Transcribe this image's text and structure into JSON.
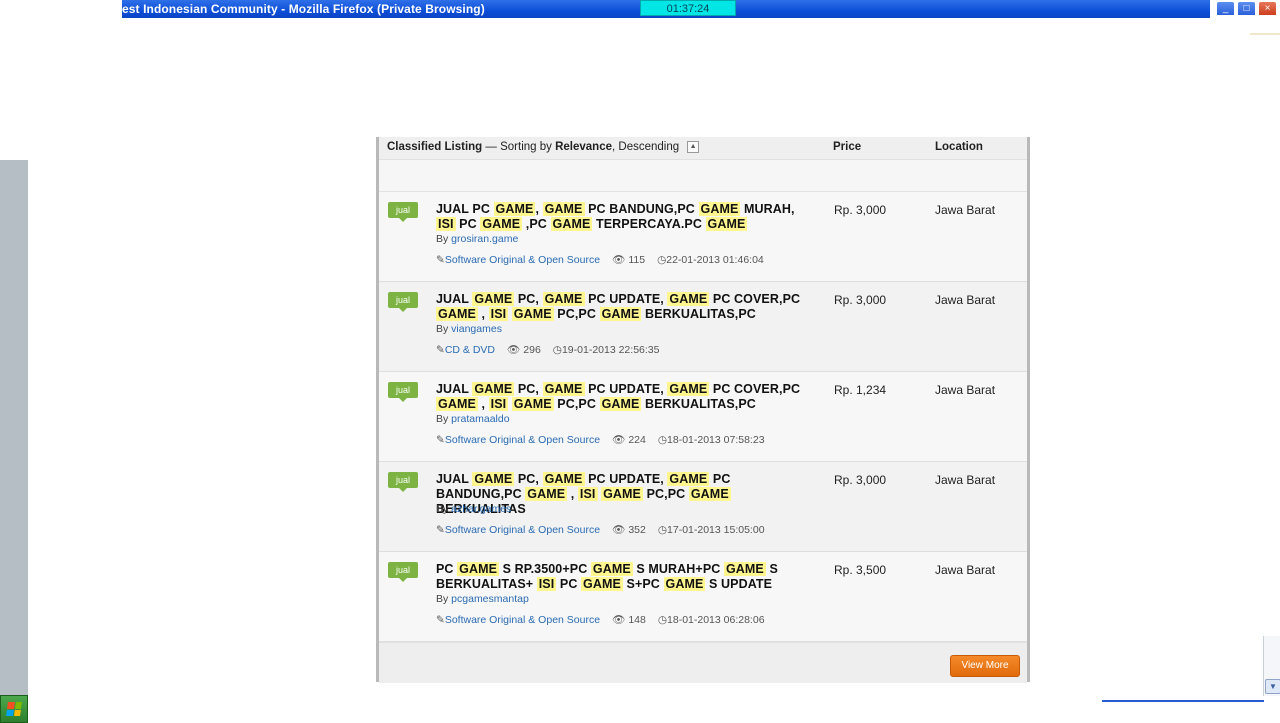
{
  "window": {
    "title": "est Indonesian Community - Mozilla Firefox (Private Browsing)",
    "clock": "01:37:24",
    "minimize_label": "_",
    "maximize_label": "□",
    "close_label": "×"
  },
  "listing": {
    "header": {
      "title": "Classified Listing",
      "sort_prefix": " — Sorting by ",
      "sort_field": "Relevance",
      "sort_order": ", Descending",
      "sort_toggle": "▲",
      "price_label": "Price",
      "location_label": "Location"
    },
    "items": [
      {
        "badge": "jual",
        "title": "JUAL PC <hl>GAME</hl>, <hl>GAME</hl> PC BANDUNG,PC <hl>GAME</hl> MURAH, <hl>ISI</hl> PC <hl>GAME</hl> ,PC <hl>GAME</hl> TERPERCAYA.PC <hl>GAME</hl>",
        "by_prefix": "By ",
        "seller": "grosiran.game",
        "category": "Software Original & Open Source",
        "views": "115",
        "date": "22-01-2013 01:46:04",
        "price": "Rp. 3,000",
        "location": "Jawa Barat"
      },
      {
        "badge": "jual",
        "title": "JUAL <hl>GAME</hl> PC, <hl>GAME</hl> PC UPDATE, <hl>GAME</hl> PC COVER,PC <hl>GAME</hl> , <hl>ISI</hl> <hl>GAME</hl> PC,PC <hl>GAME</hl> BERKUALITAS,PC",
        "by_prefix": "By ",
        "seller": "viangames",
        "category": "CD & DVD",
        "views": "296",
        "date": "19-01-2013 22:56:35",
        "price": "Rp. 3,000",
        "location": "Jawa Barat"
      },
      {
        "badge": "jual",
        "title": "JUAL <hl>GAME</hl> PC, <hl>GAME</hl> PC UPDATE, <hl>GAME</hl> PC COVER,PC <hl>GAME</hl> , <hl>ISI</hl> <hl>GAME</hl> PC,PC <hl>GAME</hl> BERKUALITAS,PC",
        "by_prefix": "By ",
        "seller": "pratamaaldo",
        "category": "Software Original & Open Source",
        "views": "224",
        "date": "18-01-2013 07:58:23",
        "price": "Rp. 1,234",
        "location": "Jawa Barat"
      },
      {
        "badge": "jual",
        "title": "JUAL <hl>GAME</hl> PC, <hl>GAME</hl> PC UPDATE, <hl>GAME</hl> PC BANDUNG,PC <hl>GAME</hl> , <hl>ISI</hl> <hl>GAME</hl> PC,PC <hl>GAME</hl> BERKUALITAS",
        "by_prefix": "By ",
        "seller": "azhar.games",
        "category": "Software Original & Open Source",
        "views": "352",
        "date": "17-01-2013 15:05:00",
        "price": "Rp. 3,000",
        "location": "Jawa Barat"
      },
      {
        "badge": "jual",
        "title": "PC <hl>GAME</hl> S RP.3500+PC <hl>GAME</hl> S MURAH+PC <hl>GAME</hl> S BERKUALITAS+ <hl>ISI</hl> PC <hl>GAME</hl> S+PC <hl>GAME</hl> S UPDATE",
        "by_prefix": "By ",
        "seller": "pcgamesmantap",
        "category": "Software Original & Open Source",
        "views": "148",
        "date": "18-01-2013 06:28:06",
        "price": "Rp. 3,500",
        "location": "Jawa Barat"
      }
    ],
    "view_more": "View More"
  },
  "icons": {
    "tag": "✎",
    "eye": "👁",
    "clock": "◷"
  },
  "colors": {
    "badge": "#7cb342",
    "highlight": "#fff68f",
    "link": "#2a6bb3",
    "view_more": "#f0780f",
    "titlebar": "#0d4fd8"
  }
}
